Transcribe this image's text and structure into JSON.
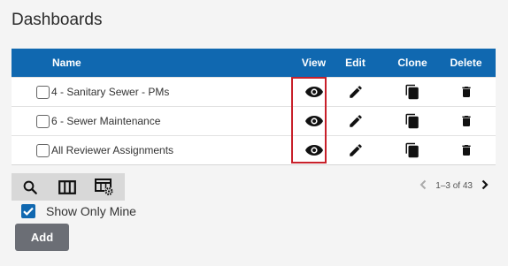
{
  "page": {
    "title": "Dashboards"
  },
  "table": {
    "headers": {
      "name": "Name",
      "view": "View",
      "edit": "Edit",
      "clone": "Clone",
      "delete": "Delete"
    },
    "rows": [
      {
        "name": "4 - Sanitary Sewer - PMs"
      },
      {
        "name": "6 - Sewer Maintenance"
      },
      {
        "name": "All Reviewer Assignments"
      }
    ]
  },
  "toolbar": {
    "icons": [
      "search-icon",
      "columns-icon",
      "table-settings-icon"
    ]
  },
  "pagination": {
    "range": "1–3 of 43"
  },
  "filters": {
    "show_only_mine_label": "Show Only Mine",
    "show_only_mine_checked": true
  },
  "actions": {
    "add_label": "Add"
  },
  "colors": {
    "header": "#1068b0",
    "highlight": "#c8202a",
    "add_button": "#6b6e75"
  }
}
